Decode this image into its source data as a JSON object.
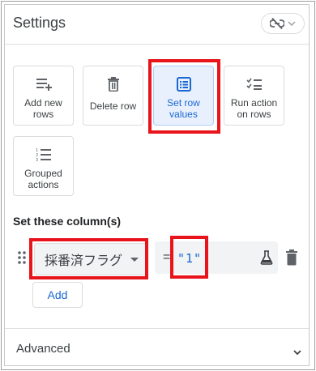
{
  "header": {
    "title": "Settings",
    "link_icon": "link-off-icon",
    "dropdown_icon": "chevron-down-icon"
  },
  "actions": [
    {
      "label": "Add new\nrows",
      "icon": "add-rows-icon",
      "selected": false
    },
    {
      "label": "Delete row",
      "icon": "trash-icon",
      "selected": false
    },
    {
      "label": "Set row\nvalues",
      "icon": "table-edit-icon",
      "selected": true
    },
    {
      "label": "Run action\non rows",
      "icon": "checklist-icon",
      "selected": false
    },
    {
      "label": "Grouped\nactions",
      "icon": "numbered-list-icon",
      "selected": false
    }
  ],
  "columns_section": {
    "title": "Set these column(s)",
    "column_select": "採番済フラグ",
    "equals": "=",
    "expression_value": "\"1\"",
    "expression_icon": "flask-icon",
    "delete_icon": "trash-icon",
    "drag_icon": "drag-handle-icon",
    "add_label": "Add"
  },
  "advanced": {
    "label": "Advanced",
    "icon": "chevron-down-icon"
  },
  "colors": {
    "accent": "#1967d2",
    "selected_bg": "#e8f0fe",
    "highlight": "#e8141b"
  }
}
